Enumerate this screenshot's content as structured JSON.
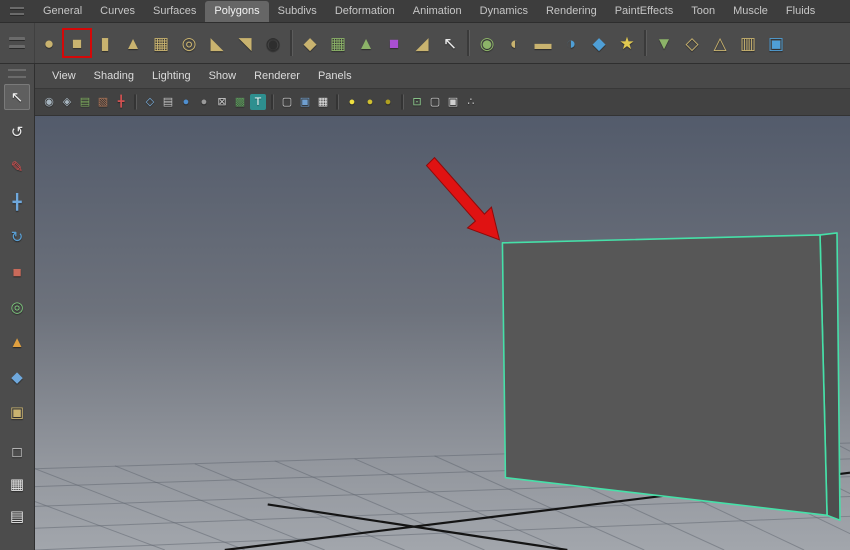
{
  "colors": {
    "selection-green": "#46e0a8",
    "arrow-red": "#e01212",
    "highlight-red": "#d40808",
    "shelf-khaki": "#c9b36f",
    "viewport-top": "#535b6b",
    "viewport-mid": "#6d727c",
    "viewport-low": "#93979e",
    "viewport-bottom": "#a2a6ac",
    "object-fill": "#575757",
    "object-side-fill": "#4e4e4e"
  },
  "menubar": {
    "tabs": [
      {
        "label": "General"
      },
      {
        "label": "Curves"
      },
      {
        "label": "Surfaces"
      },
      {
        "label": "Polygons",
        "active": true
      },
      {
        "label": "Subdivs"
      },
      {
        "label": "Deformation"
      },
      {
        "label": "Animation"
      },
      {
        "label": "Dynamics"
      },
      {
        "label": "Rendering"
      },
      {
        "label": "PaintEffects"
      },
      {
        "label": "Toon"
      },
      {
        "label": "Muscle"
      },
      {
        "label": "Fluids"
      }
    ]
  },
  "shelf": {
    "icons": [
      {
        "name": "poly-sphere-icon",
        "glyph": "●",
        "color": "#c9b36f"
      },
      {
        "name": "poly-cube-icon",
        "glyph": "■",
        "color": "#c9b36f",
        "highlighted": true
      },
      {
        "name": "poly-cylinder-icon",
        "glyph": "▮",
        "color": "#c9b36f"
      },
      {
        "name": "poly-cone-icon",
        "glyph": "▲",
        "color": "#c9b36f"
      },
      {
        "name": "poly-plane-icon",
        "glyph": "▦",
        "color": "#c9b36f"
      },
      {
        "name": "poly-torus-icon",
        "glyph": "◎",
        "color": "#c9b36f"
      },
      {
        "name": "poly-prism-icon",
        "glyph": "◣",
        "color": "#c9b36f"
      },
      {
        "name": "poly-pyramid-icon",
        "glyph": "◥",
        "color": "#c9b36f"
      },
      {
        "name": "poly-soccer-ball-icon",
        "glyph": "◉",
        "color": "#2e2e2e"
      },
      {
        "type": "sep",
        "name": "shelf-separator"
      },
      {
        "name": "smooth-icon",
        "glyph": "◆",
        "color": "#c9b36f"
      },
      {
        "name": "add-divisions-icon",
        "glyph": "▦",
        "color": "#8cb368"
      },
      {
        "name": "extrude-icon",
        "glyph": "▲",
        "color": "#8cb368"
      },
      {
        "name": "subdiv-proxy-icon",
        "glyph": "■",
        "color": "#a94fd2"
      },
      {
        "name": "crease-tool-icon",
        "glyph": "◢",
        "color": "#c9b36f"
      },
      {
        "name": "interactive-split-icon",
        "glyph": "↖",
        "color": "#e8e8e8"
      },
      {
        "type": "sep",
        "name": "shelf-separator"
      },
      {
        "name": "merge-vertices-icon",
        "glyph": "◉",
        "color": "#8cb368"
      },
      {
        "name": "bevel-icon",
        "glyph": "◐",
        "color": "#c9b36f"
      },
      {
        "name": "bridge-icon",
        "glyph": "▬",
        "color": "#c9b36f"
      },
      {
        "name": "boolean-icon",
        "glyph": "◑",
        "color": "#4f9fd6"
      },
      {
        "name": "mirror-geometry-icon",
        "glyph": "◆",
        "color": "#4f9fd6"
      },
      {
        "name": "sculpt-geometry-icon",
        "glyph": "★",
        "color": "#e0c850"
      },
      {
        "type": "sep",
        "name": "shelf-separator"
      },
      {
        "name": "normals-icon",
        "glyph": "▼",
        "color": "#8cb368"
      },
      {
        "name": "split-edge-icon",
        "glyph": "◇",
        "color": "#c9b36f"
      },
      {
        "name": "append-polygon-icon",
        "glyph": "△",
        "color": "#c9b36f"
      },
      {
        "name": "insert-edge-loop-icon",
        "glyph": "▥",
        "color": "#c9b36f"
      },
      {
        "name": "uv-mapping-icon",
        "glyph": "▣",
        "color": "#4f9fd6"
      }
    ]
  },
  "toolbox": {
    "tools": [
      {
        "name": "select-tool",
        "glyph": "↖",
        "color": "#f0f0f0",
        "active": true
      },
      {
        "name": "lasso-select-tool",
        "glyph": "↺",
        "color": "#e8e8e8"
      },
      {
        "name": "paint-select-tool",
        "glyph": "✎",
        "color": "#d65050"
      },
      {
        "name": "move-tool",
        "glyph": "╋",
        "color": "#6fa8dc"
      },
      {
        "name": "rotate-tool",
        "glyph": "↻",
        "color": "#5a9fd4"
      },
      {
        "name": "scale-tool",
        "glyph": "■",
        "color": "#c96a5a"
      },
      {
        "name": "universal-manipulator-tool",
        "glyph": "◎",
        "color": "#7dc87d"
      },
      {
        "name": "soft-modification-tool",
        "glyph": "▲",
        "color": "#e0a040"
      },
      {
        "name": "show-manipulator-tool",
        "glyph": "◆",
        "color": "#6fa8dc"
      },
      {
        "name": "last-tool-icon",
        "glyph": "▣",
        "color": "#c9b36f"
      }
    ],
    "layouts": [
      {
        "name": "single-pane-layout-button",
        "glyph": "□",
        "color": "#e8e8e8"
      },
      {
        "name": "four-pane-layout-button",
        "glyph": "▦",
        "color": "#e8e8e8"
      },
      {
        "name": "split-pane-layout-button",
        "glyph": "▤",
        "color": "#e8e8e8"
      }
    ]
  },
  "panel": {
    "menus": [
      {
        "label": "View"
      },
      {
        "label": "Shading"
      },
      {
        "label": "Lighting"
      },
      {
        "label": "Show"
      },
      {
        "label": "Renderer"
      },
      {
        "label": "Panels"
      }
    ],
    "toolbar_icons": [
      {
        "name": "select-camera-icon",
        "glyph": "◉",
        "color": "#a8b6c0"
      },
      {
        "name": "camera-attributes-icon",
        "glyph": "◈",
        "color": "#a8b6c0"
      },
      {
        "name": "bookmarks-icon",
        "glyph": "▤",
        "color": "#7fae5f"
      },
      {
        "name": "image-plane-icon",
        "glyph": "▧",
        "color": "#b0785a"
      },
      {
        "name": "axis-icon",
        "glyph": "╋",
        "color": "#d05050"
      },
      {
        "type": "sep",
        "name": "toolbar-separator"
      },
      {
        "name": "wireframe-mode-icon",
        "glyph": "◇",
        "color": "#7ab0e0"
      },
      {
        "name": "film-gate-icon",
        "glyph": "▤",
        "color": "#c8c8c8"
      },
      {
        "name": "shaded-mode-icon",
        "glyph": "●",
        "color": "#4f8fd0"
      },
      {
        "name": "textured-mode-icon",
        "glyph": "●",
        "color": "#9a9a9a"
      },
      {
        "name": "no-image-icon",
        "glyph": "⊠",
        "color": "#c8c8c8"
      },
      {
        "name": "render-region-icon",
        "glyph": "▩",
        "color": "#5f9f5f"
      },
      {
        "name": "texture-view-icon",
        "glyph": "T",
        "color": "#ffffff",
        "bg": "#2e8f8f"
      },
      {
        "type": "sep",
        "name": "toolbar-separator"
      },
      {
        "name": "default-material-icon",
        "glyph": "▢",
        "color": "#d0d0d0"
      },
      {
        "name": "xray-icon",
        "glyph": "▣",
        "color": "#6f9fd0"
      },
      {
        "name": "transparency-icon",
        "glyph": "▦",
        "color": "#e8e8e8"
      },
      {
        "type": "sep",
        "name": "toolbar-separator"
      },
      {
        "name": "all-lights-icon",
        "glyph": "●",
        "color": "#f0e040"
      },
      {
        "name": "selected-lights-icon",
        "glyph": "●",
        "color": "#d0c030"
      },
      {
        "name": "default-light-icon",
        "glyph": "●",
        "color": "#b0a020"
      },
      {
        "type": "sep",
        "name": "toolbar-separator"
      },
      {
        "name": "highlight-selection-icon",
        "glyph": "⊡",
        "color": "#8fd08f"
      },
      {
        "name": "isolate-select-icon",
        "glyph": "▢",
        "color": "#d0d0d0"
      },
      {
        "name": "frame-all-icon",
        "glyph": "▣",
        "color": "#d0d0d0"
      },
      {
        "name": "share-view-icon",
        "glyph": "∴",
        "color": "#d0d0d0"
      }
    ]
  }
}
